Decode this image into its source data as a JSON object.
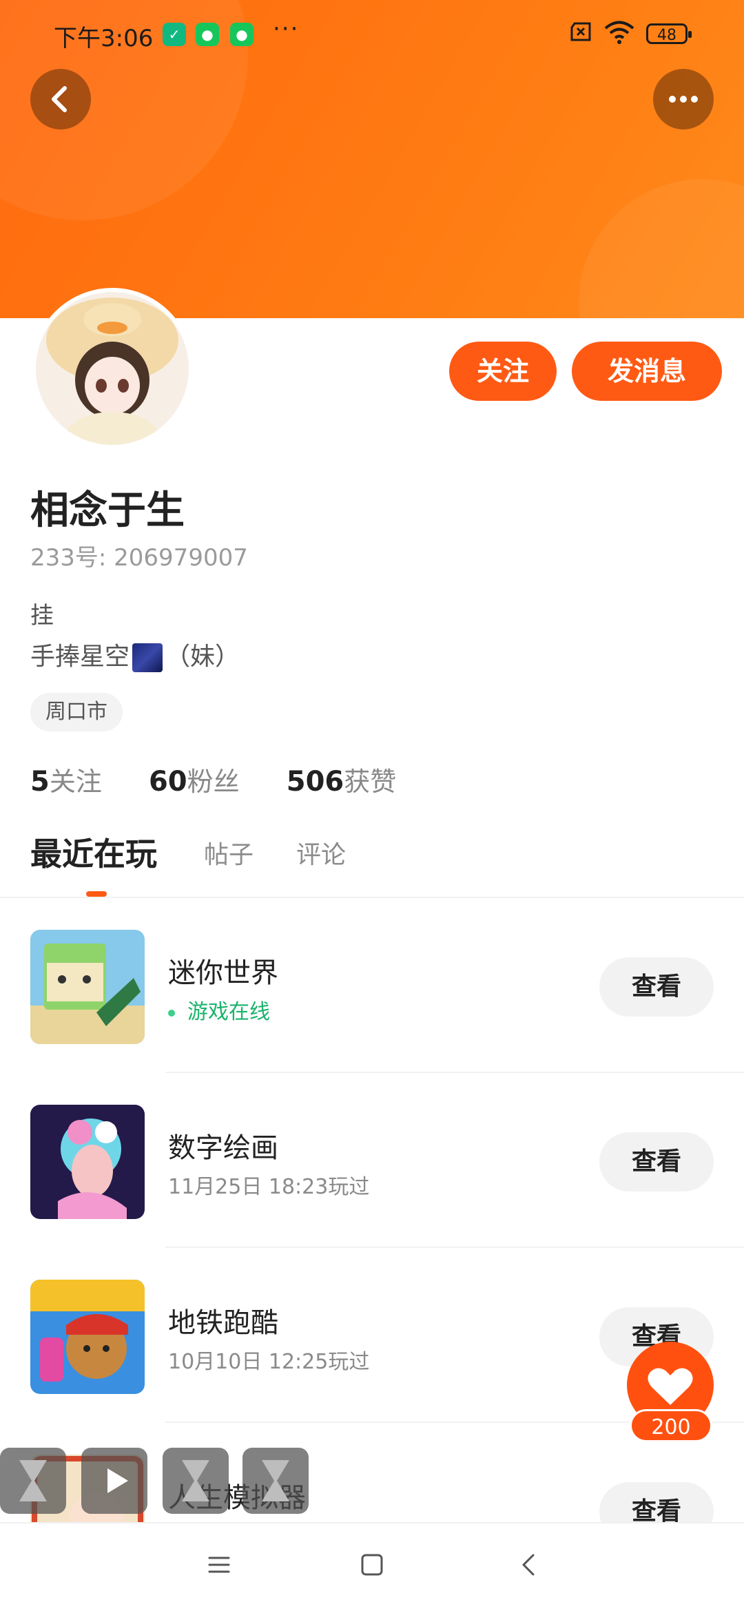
{
  "status_bar": {
    "time": "下午3:06",
    "battery": "48",
    "more_dots": "···"
  },
  "header": {
    "back_icon": "chevron-left-icon",
    "more_icon": "more-horizontal-icon"
  },
  "profile": {
    "name": "相念于生",
    "uid": "233号: 206979007",
    "bio_line1": "挂",
    "bio_line2_prefix": "手捧星空",
    "bio_line2_suffix": "（妹）",
    "location_tag": "周口市",
    "follow_label": "关注",
    "message_label": "发消息"
  },
  "stats": [
    {
      "num": "5",
      "label": "关注"
    },
    {
      "num": "60",
      "label": "粉丝"
    },
    {
      "num": "506",
      "label": "获赞"
    }
  ],
  "tabs": [
    {
      "label": "最近在玩",
      "active": true
    },
    {
      "label": "帖子",
      "active": false
    },
    {
      "label": "评论",
      "active": false
    }
  ],
  "games": [
    {
      "title": "迷你世界",
      "sub": "游戏在线",
      "online": true,
      "button": "查看"
    },
    {
      "title": "数字绘画",
      "sub": "11月25日 18:23玩过",
      "online": false,
      "button": "查看"
    },
    {
      "title": "地铁跑酷",
      "sub": "10月10日 12:25玩过",
      "online": false,
      "button": "查看"
    },
    {
      "title": "人生模拟器",
      "sub": "",
      "online": false,
      "button": "查看"
    }
  ],
  "like_fab": {
    "count": "200"
  },
  "colors": {
    "brand_orange": "#ff5a14",
    "banner_orange": "#ff7a12",
    "online_green": "#19b36b"
  }
}
